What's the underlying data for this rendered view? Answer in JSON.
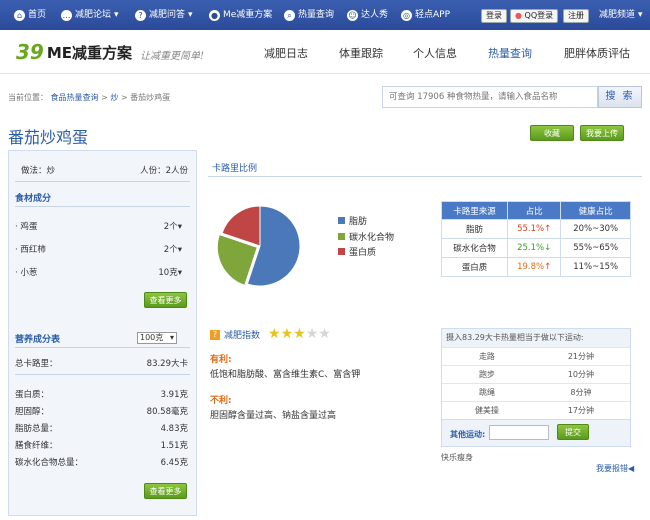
{
  "topbar": {
    "nav": [
      {
        "icon": "home-icon",
        "label": "首页",
        "caret": ""
      },
      {
        "icon": "chat-icon",
        "label": "减肥论坛",
        "caret": "▾"
      },
      {
        "icon": "qa-icon",
        "label": "减肥问答",
        "caret": "▾"
      },
      {
        "icon": "user-icon",
        "label": "Me减重方案",
        "caret": ""
      },
      {
        "icon": "search-icon",
        "label": "热量查询",
        "caret": ""
      },
      {
        "icon": "people-icon",
        "label": "达人秀",
        "caret": ""
      },
      {
        "icon": "app-icon",
        "label": "轻点APP",
        "caret": ""
      }
    ],
    "login": "登录",
    "qq_login": "QQ登录",
    "register": "注册",
    "channel": "减肥频道",
    "channel_caret": "▾"
  },
  "header": {
    "logo_mark": "39",
    "logo_brand": "ME减重方案",
    "slogan": "让减重更简单!",
    "nav": [
      "减肥日志",
      "体重跟踪",
      "个人信息",
      "热量查询",
      "肥胖体质评估"
    ],
    "active_nav": "热量查询"
  },
  "breadcrumb": {
    "prefix": "当前位置：",
    "items": [
      "食品热量查询",
      "炒",
      "番茄炒鸡蛋"
    ],
    "separator": ">"
  },
  "search": {
    "placeholder": "可查询 17906 种食物热量，请输入食品名称",
    "button": "搜 索"
  },
  "food_title": "番茄炒鸡蛋",
  "actions": {
    "favorite": "收藏",
    "upload": "我要上传"
  },
  "sidebar": {
    "method": "做法：炒",
    "servings": "人份：2人份",
    "ingredients_title": "食材成分",
    "ingredients": [
      {
        "name": "鸡蛋",
        "qty": "2个"
      },
      {
        "name": "西红柿",
        "qty": "2个"
      },
      {
        "name": "小葱",
        "qty": "10克"
      }
    ],
    "more": "查看更多",
    "nutrition_title": "营养成分表",
    "unit_select": "100克",
    "total_label": "总卡路里：",
    "total_value": "83.29大卡",
    "nutrients": [
      {
        "name": "蛋白质：",
        "value": "3.91克"
      },
      {
        "name": "胆固醇：",
        "value": "80.58毫克"
      },
      {
        "name": "脂肪总量：",
        "value": "4.83克"
      },
      {
        "name": "膳食纤维：",
        "value": "1.51克"
      },
      {
        "name": "碳水化合物总量：",
        "value": "6.45克"
      }
    ],
    "more2": "查看更多"
  },
  "calorie_section": {
    "title": "卡路里比例",
    "legend": [
      {
        "label": "脂肪",
        "color": "#4a78b8"
      },
      {
        "label": "碳水化合物",
        "color": "#7ea63b"
      },
      {
        "label": "蛋白质",
        "color": "#c04545"
      }
    ],
    "table_headers": [
      "卡路里来源",
      "占比",
      "健康占比"
    ],
    "rows": [
      {
        "source": "脂肪",
        "pct": "55.1%",
        "arrow": "↑",
        "healthy": "20%~30%"
      },
      {
        "source": "碳水化合物",
        "pct": "25.1%",
        "arrow": "↓",
        "healthy": "55%~65%"
      },
      {
        "source": "蛋白质",
        "pct": "19.8%",
        "arrow": "↑",
        "healthy": "11%~15%"
      }
    ]
  },
  "chart_data": {
    "type": "pie",
    "categories": [
      "脂肪",
      "碳水化合物",
      "蛋白质"
    ],
    "values": [
      55.1,
      25.1,
      19.8
    ],
    "colors": [
      "#4a78b8",
      "#7ea63b",
      "#c04545"
    ]
  },
  "diet_index": {
    "label": "减肥指数",
    "stars": 3,
    "max_stars": 5,
    "pros_title": "有利:",
    "pros": "低饱和脂肪酸、富含维生素C、富含钾",
    "cons_title": "不利:",
    "cons": "胆固醇含量过高、钠盐含量过高"
  },
  "exercise": {
    "title": "摄入83.29大卡热量相当于做以下运动:",
    "rows": [
      {
        "name": "走路",
        "time": "21分钟"
      },
      {
        "name": "跑步",
        "time": "10分钟"
      },
      {
        "name": "跳绳",
        "time": "8分钟"
      },
      {
        "name": "健美操",
        "time": "17分钟"
      }
    ],
    "other_label": "其他运动:",
    "submit": "提交"
  },
  "bottom": {
    "happy": "快乐瘦身",
    "report": "我要报错"
  }
}
